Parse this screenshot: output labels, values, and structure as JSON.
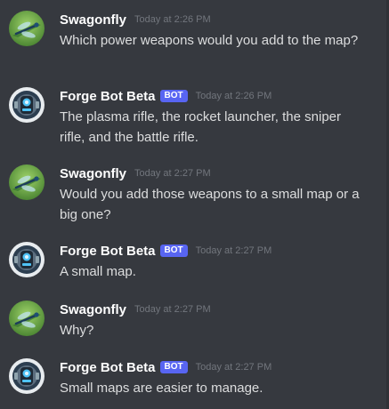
{
  "messages": [
    {
      "username": "Swagonfly",
      "avatar": "dragonfly-avatar",
      "bot": false,
      "timestamp": "Today at 2:26 PM",
      "text": "Which power weapons would you add to the map?"
    },
    {
      "username": "Forge Bot Beta",
      "avatar": "robot-avatar",
      "bot": true,
      "bot_tag": "BOT",
      "timestamp": "Today at 2:26 PM",
      "text": "The plasma rifle, the rocket launcher, the sniper rifle, and the battle rifle."
    },
    {
      "username": "Swagonfly",
      "avatar": "dragonfly-avatar",
      "bot": false,
      "timestamp": "Today at 2:27 PM",
      "text": "Would you add those weapons to a small map or a big one?"
    },
    {
      "username": "Forge Bot Beta",
      "avatar": "robot-avatar",
      "bot": true,
      "bot_tag": "BOT",
      "timestamp": "Today at 2:27 PM",
      "text": "A small map."
    },
    {
      "username": "Swagonfly",
      "avatar": "dragonfly-avatar",
      "bot": false,
      "timestamp": "Today at 2:27 PM",
      "text": "Why?"
    },
    {
      "username": "Forge Bot Beta",
      "avatar": "robot-avatar",
      "bot": true,
      "bot_tag": "BOT",
      "timestamp": "Today at 2:27 PM",
      "text": "Small maps are easier to manage."
    }
  ],
  "colors": {
    "background": "#36393f",
    "username": "#ffffff",
    "text": "#dcddde",
    "timestamp": "#72767d",
    "bot_tag": "#5865f2"
  }
}
